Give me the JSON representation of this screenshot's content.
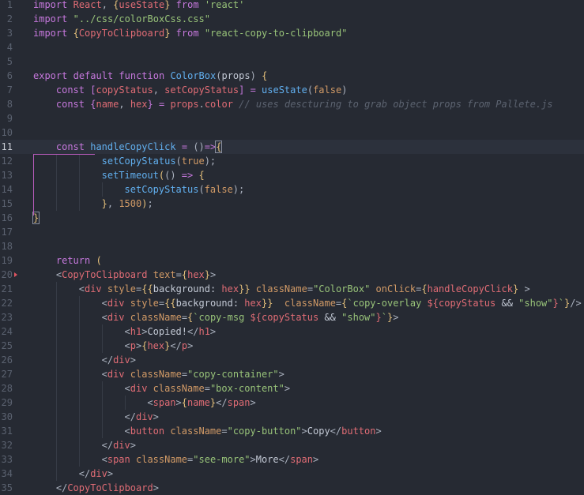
{
  "editor": {
    "language": "javascript-jsx",
    "colors": {
      "background": "#262a33",
      "keyword": "#c678dd",
      "function": "#61afef",
      "string": "#98c379",
      "variable": "#e06c75",
      "number": "#d19a66",
      "comment": "#5c6370"
    },
    "active_line": 11,
    "lines": [
      {
        "n": "1",
        "indent": 0,
        "tokens": [
          [
            "kw",
            "import"
          ],
          [
            "txt",
            " "
          ],
          [
            "var",
            "React"
          ],
          [
            "punc",
            ", "
          ],
          [
            "br",
            "{"
          ],
          [
            "var",
            "useState"
          ],
          [
            "br",
            "}"
          ],
          [
            "txt",
            " "
          ],
          [
            "kw",
            "from"
          ],
          [
            "txt",
            " "
          ],
          [
            "str",
            "'react'"
          ]
        ]
      },
      {
        "n": "2",
        "indent": 0,
        "tokens": [
          [
            "kw",
            "import"
          ],
          [
            "txt",
            " "
          ],
          [
            "str",
            "\"../css/colorBoxCss.css\""
          ]
        ]
      },
      {
        "n": "3",
        "indent": 0,
        "tokens": [
          [
            "kw",
            "import"
          ],
          [
            "txt",
            " "
          ],
          [
            "br",
            "{"
          ],
          [
            "var",
            "CopyToClipboard"
          ],
          [
            "br",
            "}"
          ],
          [
            "txt",
            " "
          ],
          [
            "kw",
            "from"
          ],
          [
            "txt",
            " "
          ],
          [
            "str",
            "\"react-copy-to-clipboard\""
          ]
        ]
      },
      {
        "n": "4",
        "indent": 0,
        "tokens": []
      },
      {
        "n": "5",
        "indent": 0,
        "tokens": []
      },
      {
        "n": "6",
        "indent": 0,
        "tokens": [
          [
            "kw",
            "export"
          ],
          [
            "txt",
            " "
          ],
          [
            "kw",
            "default"
          ],
          [
            "txt",
            " "
          ],
          [
            "kw",
            "function"
          ],
          [
            "txt",
            " "
          ],
          [
            "fn",
            "ColorBox"
          ],
          [
            "punc",
            "("
          ],
          [
            "txt",
            "props"
          ],
          [
            "punc",
            ")"
          ],
          [
            "txt",
            " "
          ],
          [
            "br",
            "{"
          ]
        ]
      },
      {
        "n": "7",
        "indent": 1,
        "tokens": [
          [
            "kw",
            "const"
          ],
          [
            "txt",
            " "
          ],
          [
            "brp",
            "["
          ],
          [
            "var",
            "copyStatus"
          ],
          [
            "punc",
            ", "
          ],
          [
            "var",
            "setCopyStatus"
          ],
          [
            "brp",
            "]"
          ],
          [
            "txt",
            " "
          ],
          [
            "kw",
            "="
          ],
          [
            "txt",
            " "
          ],
          [
            "fn",
            "useState"
          ],
          [
            "punc",
            "("
          ],
          [
            "num",
            "false"
          ],
          [
            "punc",
            ")"
          ]
        ]
      },
      {
        "n": "8",
        "indent": 1,
        "tokens": [
          [
            "kw",
            "const"
          ],
          [
            "txt",
            " "
          ],
          [
            "brp",
            "{"
          ],
          [
            "var",
            "name"
          ],
          [
            "punc",
            ", "
          ],
          [
            "var",
            "hex"
          ],
          [
            "brp",
            "}"
          ],
          [
            "txt",
            " "
          ],
          [
            "kw",
            "="
          ],
          [
            "txt",
            " "
          ],
          [
            "var",
            "props"
          ],
          [
            "punc",
            "."
          ],
          [
            "var",
            "color"
          ],
          [
            "txt",
            " "
          ],
          [
            "com",
            "// uses descturing to grab object props from Pallete.js"
          ]
        ]
      },
      {
        "n": "9",
        "indent": 0,
        "tokens": []
      },
      {
        "n": "10",
        "indent": 0,
        "tokens": []
      },
      {
        "n": "11",
        "indent": 1,
        "tokens": [
          [
            "kw",
            "const"
          ],
          [
            "txt",
            " "
          ],
          [
            "fn",
            "handleCopyClick"
          ],
          [
            "txt",
            " "
          ],
          [
            "kw",
            "="
          ],
          [
            "txt",
            " "
          ],
          [
            "punc",
            "()"
          ],
          [
            "kw",
            "=>"
          ],
          [
            "brm",
            "{"
          ]
        ]
      },
      {
        "n": "12",
        "indent": 3,
        "tokens": [
          [
            "fn",
            "setCopyStatus"
          ],
          [
            "punc",
            "("
          ],
          [
            "num",
            "true"
          ],
          [
            "punc",
            ");"
          ]
        ]
      },
      {
        "n": "13",
        "indent": 3,
        "tokens": [
          [
            "fn",
            "setTimeout"
          ],
          [
            "br",
            "("
          ],
          [
            "punc",
            "()"
          ],
          [
            "txt",
            " "
          ],
          [
            "kw",
            "=>"
          ],
          [
            "txt",
            " "
          ],
          [
            "br",
            "{"
          ]
        ]
      },
      {
        "n": "14",
        "indent": 4,
        "tokens": [
          [
            "fn",
            "setCopyStatus"
          ],
          [
            "punc",
            "("
          ],
          [
            "num",
            "false"
          ],
          [
            "punc",
            ");"
          ]
        ]
      },
      {
        "n": "15",
        "indent": 3,
        "tokens": [
          [
            "br",
            "}"
          ],
          [
            "punc",
            ", "
          ],
          [
            "num",
            "1500"
          ],
          [
            "br",
            ")"
          ],
          [
            "punc",
            ";"
          ]
        ]
      },
      {
        "n": "16",
        "indent": 0,
        "tokens": [
          [
            "brm",
            "}"
          ]
        ]
      },
      {
        "n": "17",
        "indent": 0,
        "tokens": []
      },
      {
        "n": "18",
        "indent": 0,
        "tokens": []
      },
      {
        "n": "19",
        "indent": 1,
        "tokens": [
          [
            "kw",
            "return"
          ],
          [
            "txt",
            " "
          ],
          [
            "br",
            "("
          ]
        ]
      },
      {
        "n": "20",
        "indent": 1,
        "tokens": [
          [
            "punc",
            "<"
          ],
          [
            "tag",
            "CopyToClipboard"
          ],
          [
            "txt",
            " "
          ],
          [
            "attr",
            "text"
          ],
          [
            "punc",
            "="
          ],
          [
            "br",
            "{"
          ],
          [
            "var",
            "hex"
          ],
          [
            "br",
            "}"
          ],
          [
            "punc",
            ">"
          ]
        ]
      },
      {
        "n": "21",
        "indent": 2,
        "tokens": [
          [
            "punc",
            "<"
          ],
          [
            "tag",
            "div"
          ],
          [
            "txt",
            " "
          ],
          [
            "attr",
            "style"
          ],
          [
            "punc",
            "="
          ],
          [
            "br",
            "{{"
          ],
          [
            "txt",
            "background: "
          ],
          [
            "var",
            "hex"
          ],
          [
            "br",
            "}}"
          ],
          [
            "txt",
            " "
          ],
          [
            "attr",
            "className"
          ],
          [
            "punc",
            "="
          ],
          [
            "str",
            "\"ColorBox\""
          ],
          [
            "txt",
            " "
          ],
          [
            "attr",
            "onClick"
          ],
          [
            "punc",
            "="
          ],
          [
            "br",
            "{"
          ],
          [
            "var",
            "handleCopyClick"
          ],
          [
            "br",
            "}"
          ],
          [
            "txt",
            " "
          ],
          [
            "punc",
            ">"
          ]
        ]
      },
      {
        "n": "22",
        "indent": 3,
        "tokens": [
          [
            "punc",
            "<"
          ],
          [
            "tag",
            "div"
          ],
          [
            "txt",
            " "
          ],
          [
            "attr",
            "style"
          ],
          [
            "punc",
            "="
          ],
          [
            "br",
            "{{"
          ],
          [
            "txt",
            "background: "
          ],
          [
            "var",
            "hex"
          ],
          [
            "br",
            "}}"
          ],
          [
            "txt",
            "  "
          ],
          [
            "attr",
            "className"
          ],
          [
            "punc",
            "="
          ],
          [
            "br",
            "{"
          ],
          [
            "str",
            "`copy-overlay "
          ],
          [
            "var",
            "${copyStatus"
          ],
          [
            "txt",
            " && "
          ],
          [
            "str",
            "\"show\""
          ],
          [
            "var",
            "}"
          ],
          [
            "str",
            "`"
          ],
          [
            "br",
            "}"
          ],
          [
            "punc",
            "/>"
          ]
        ]
      },
      {
        "n": "23",
        "indent": 3,
        "tokens": [
          [
            "punc",
            "<"
          ],
          [
            "tag",
            "div"
          ],
          [
            "txt",
            " "
          ],
          [
            "attr",
            "className"
          ],
          [
            "punc",
            "="
          ],
          [
            "br",
            "{"
          ],
          [
            "str",
            "`copy-msg "
          ],
          [
            "var",
            "${copyStatus"
          ],
          [
            "txt",
            " && "
          ],
          [
            "str",
            "\"show\""
          ],
          [
            "var",
            "}"
          ],
          [
            "str",
            "`"
          ],
          [
            "br",
            "}"
          ],
          [
            "punc",
            ">"
          ]
        ]
      },
      {
        "n": "24",
        "indent": 4,
        "tokens": [
          [
            "punc",
            "<"
          ],
          [
            "tag",
            "h1"
          ],
          [
            "punc",
            ">"
          ],
          [
            "txt",
            "Copied!"
          ],
          [
            "punc",
            "</"
          ],
          [
            "tag",
            "h1"
          ],
          [
            "punc",
            ">"
          ]
        ]
      },
      {
        "n": "25",
        "indent": 4,
        "tokens": [
          [
            "punc",
            "<"
          ],
          [
            "tag",
            "p"
          ],
          [
            "punc",
            ">"
          ],
          [
            "br",
            "{"
          ],
          [
            "var",
            "hex"
          ],
          [
            "br",
            "}"
          ],
          [
            "punc",
            "</"
          ],
          [
            "tag",
            "p"
          ],
          [
            "punc",
            ">"
          ]
        ]
      },
      {
        "n": "26",
        "indent": 3,
        "tokens": [
          [
            "punc",
            "</"
          ],
          [
            "tag",
            "div"
          ],
          [
            "punc",
            ">"
          ]
        ]
      },
      {
        "n": "27",
        "indent": 3,
        "tokens": [
          [
            "punc",
            "<"
          ],
          [
            "tag",
            "div"
          ],
          [
            "txt",
            " "
          ],
          [
            "attr",
            "className"
          ],
          [
            "punc",
            "="
          ],
          [
            "str",
            "\"copy-container\""
          ],
          [
            "punc",
            ">"
          ]
        ]
      },
      {
        "n": "28",
        "indent": 4,
        "tokens": [
          [
            "punc",
            "<"
          ],
          [
            "tag",
            "div"
          ],
          [
            "txt",
            " "
          ],
          [
            "attr",
            "className"
          ],
          [
            "punc",
            "="
          ],
          [
            "str",
            "\"box-content\""
          ],
          [
            "punc",
            ">"
          ]
        ]
      },
      {
        "n": "29",
        "indent": 5,
        "tokens": [
          [
            "punc",
            "<"
          ],
          [
            "tag",
            "span"
          ],
          [
            "punc",
            ">"
          ],
          [
            "br",
            "{"
          ],
          [
            "var",
            "name"
          ],
          [
            "br",
            "}"
          ],
          [
            "punc",
            "</"
          ],
          [
            "tag",
            "span"
          ],
          [
            "punc",
            ">"
          ]
        ]
      },
      {
        "n": "30",
        "indent": 4,
        "tokens": [
          [
            "punc",
            "</"
          ],
          [
            "tag",
            "div"
          ],
          [
            "punc",
            ">"
          ]
        ]
      },
      {
        "n": "31",
        "indent": 4,
        "tokens": [
          [
            "punc",
            "<"
          ],
          [
            "tag",
            "button"
          ],
          [
            "txt",
            " "
          ],
          [
            "attr",
            "className"
          ],
          [
            "punc",
            "="
          ],
          [
            "str",
            "\"copy-button\""
          ],
          [
            "punc",
            ">"
          ],
          [
            "txt",
            "Copy"
          ],
          [
            "punc",
            "</"
          ],
          [
            "tag",
            "button"
          ],
          [
            "punc",
            ">"
          ]
        ]
      },
      {
        "n": "32",
        "indent": 3,
        "tokens": [
          [
            "punc",
            "</"
          ],
          [
            "tag",
            "div"
          ],
          [
            "punc",
            ">"
          ]
        ]
      },
      {
        "n": "33",
        "indent": 3,
        "tokens": [
          [
            "punc",
            "<"
          ],
          [
            "tag",
            "span"
          ],
          [
            "txt",
            " "
          ],
          [
            "attr",
            "className"
          ],
          [
            "punc",
            "="
          ],
          [
            "str",
            "\"see-more\""
          ],
          [
            "punc",
            ">"
          ],
          [
            "txt",
            "More"
          ],
          [
            "punc",
            "</"
          ],
          [
            "tag",
            "span"
          ],
          [
            "punc",
            ">"
          ]
        ]
      },
      {
        "n": "34",
        "indent": 2,
        "tokens": [
          [
            "punc",
            "</"
          ],
          [
            "tag",
            "div"
          ],
          [
            "punc",
            ">"
          ]
        ]
      },
      {
        "n": "35",
        "indent": 1,
        "tokens": [
          [
            "punc",
            "</"
          ],
          [
            "tag",
            "CopyToClipboard"
          ],
          [
            "punc",
            ">"
          ]
        ]
      }
    ]
  }
}
